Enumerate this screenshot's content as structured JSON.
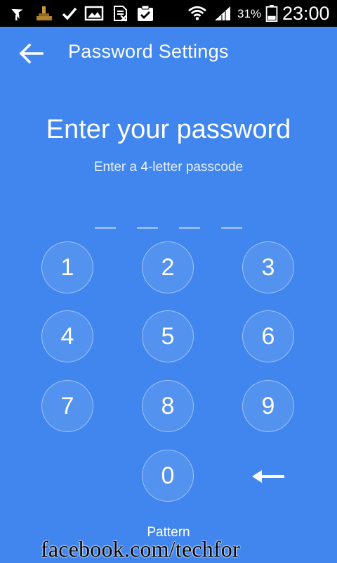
{
  "status_bar": {
    "icons": [
      "navigation-icon",
      "app-icon",
      "check-icon",
      "image-icon",
      "sim-icon",
      "clipboard-check-icon",
      "wifi-icon",
      "signal-icon",
      "battery-icon"
    ],
    "battery_percent": "31%",
    "time": "23:00"
  },
  "app_bar": {
    "title": "Password Settings"
  },
  "prompt": {
    "title": "Enter your password",
    "subtitle": "Enter a 4-letter passcode",
    "slots_filled": 0,
    "slots_total": 4
  },
  "keypad": {
    "keys": [
      "1",
      "2",
      "3",
      "4",
      "5",
      "6",
      "7",
      "8",
      "9",
      "0"
    ]
  },
  "footer": {
    "pattern_link": "Pattern",
    "watermark": "facebook.com/techfor"
  },
  "colors": {
    "background": "#4086EE",
    "status_bar": "#000000",
    "text": "#FFFFFF"
  }
}
